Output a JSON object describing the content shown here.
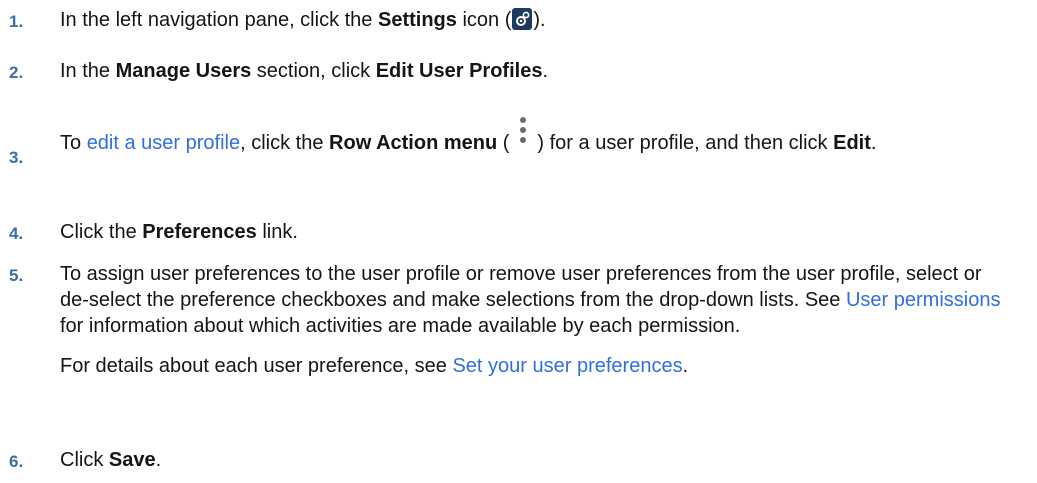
{
  "steps": [
    {
      "num": "1.",
      "t1": "In the left navigation pane, click the ",
      "b1": "Settings",
      "t2": " icon (",
      "t3": ")."
    },
    {
      "num": "2.",
      "t1": "In the ",
      "b1": "Manage Users",
      "t2": " section, click ",
      "b2": "Edit User Profiles",
      "t3": "."
    },
    {
      "num": "3.",
      "t1": "To ",
      "link": "edit a user profile",
      "t2": ", click the ",
      "b1": "Row Action menu",
      "t3": " (",
      "t4": ") for a user profile, and then click ",
      "b2": "Edit",
      "t5": "."
    },
    {
      "num": "4.",
      "t1": "Click the ",
      "b1": "Preferences",
      "t2": " link."
    },
    {
      "num": "5.",
      "t1": "To assign user preferences to the user profile or remove user preferences from the user profile, select or de-select the preference checkboxes and make selections from the drop-down lists. See ",
      "link": "User permissions",
      "t2": " for information about which activities are made available by each permission.",
      "p2_t1": "For details about each user preference, see ",
      "p2_link": "Set your user preferences",
      "p2_t2": "."
    },
    {
      "num": "6.",
      "t1": "Click ",
      "b1": "Save",
      "t2": "."
    }
  ],
  "icons": {
    "settings": "gear-icon",
    "row_action": "kebab-vertical-icon"
  },
  "colors": {
    "step_number": "#3a6ea5",
    "link": "#2f6fde",
    "text": "#161513"
  }
}
